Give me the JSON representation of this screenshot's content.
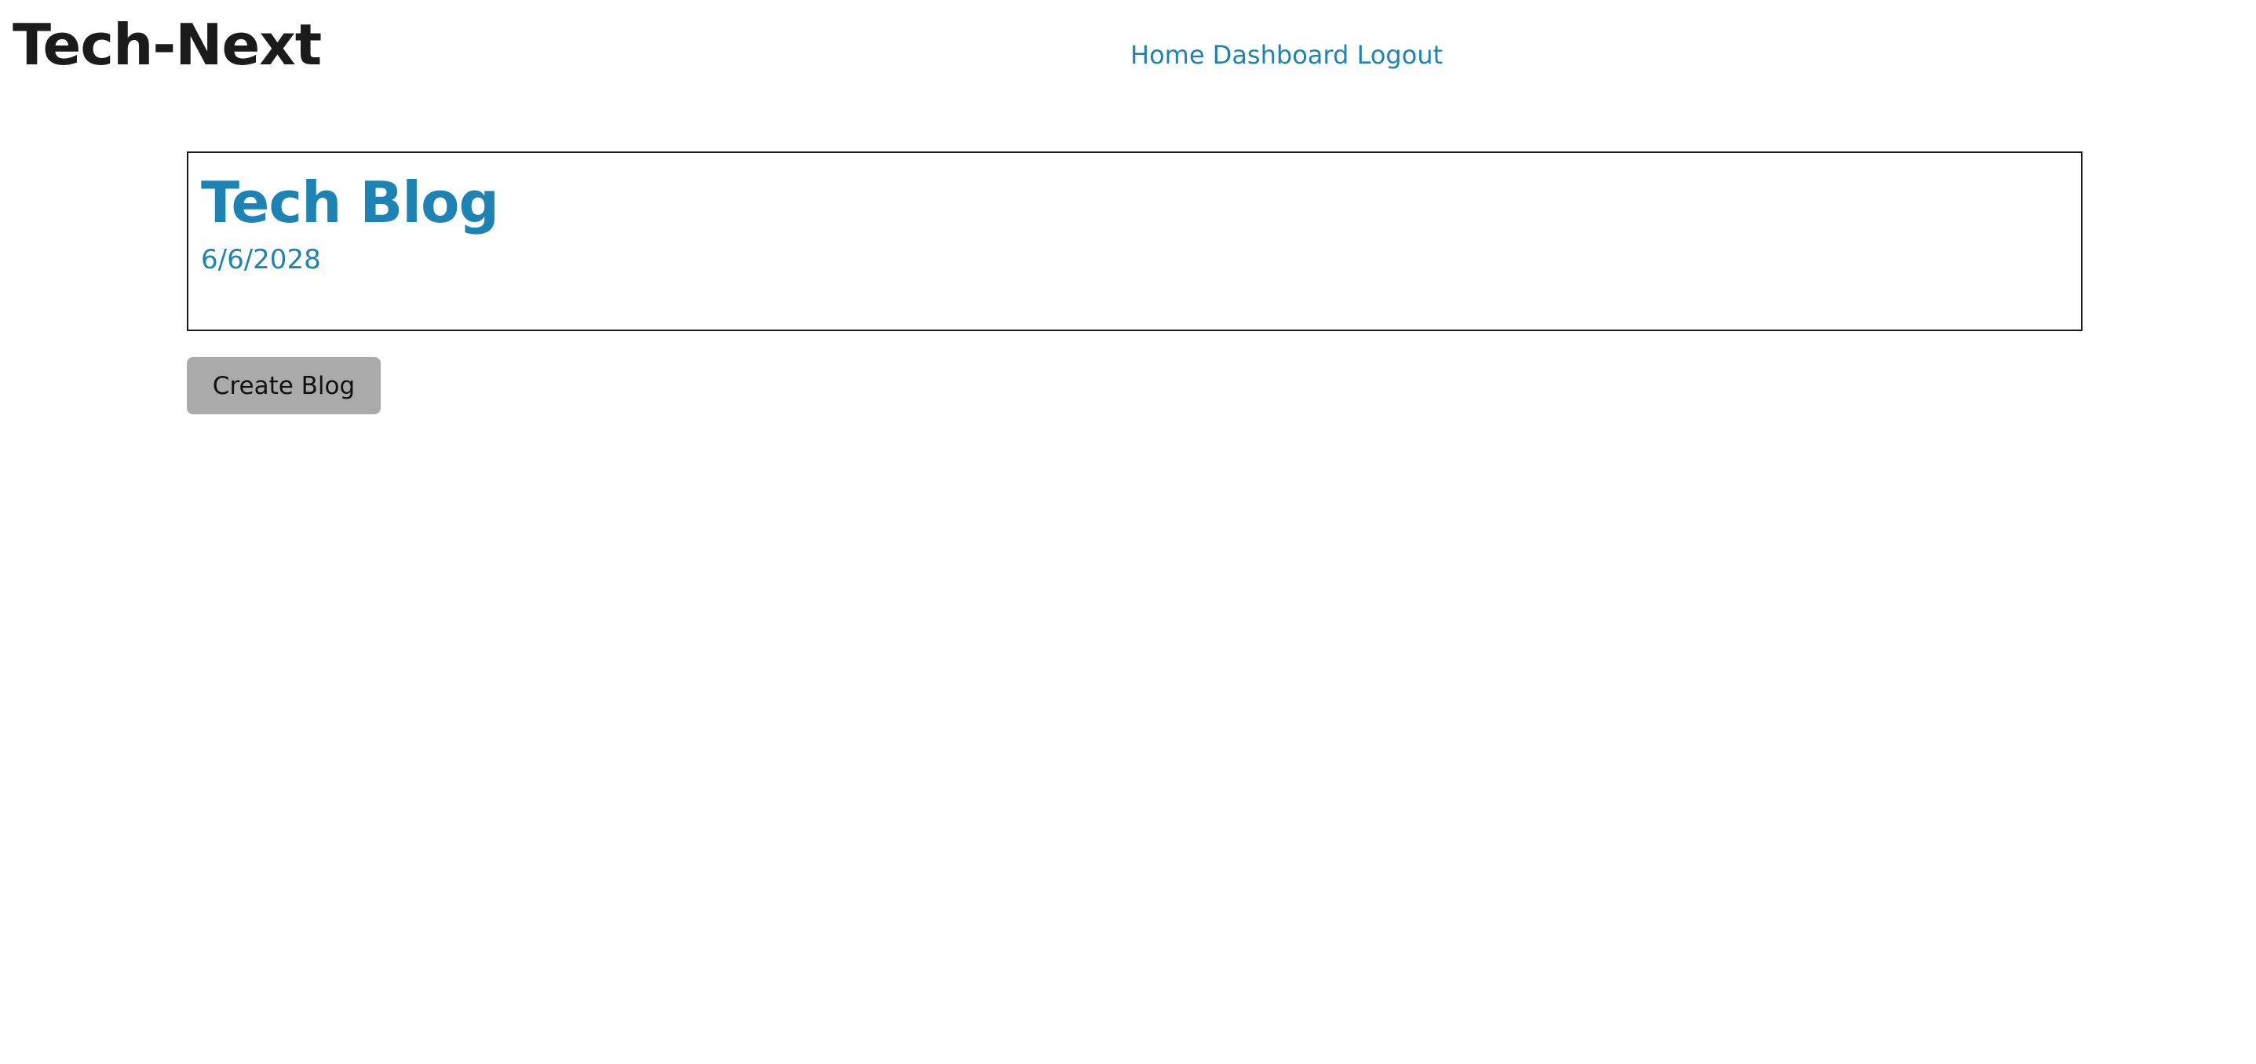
{
  "header": {
    "site_title": "Tech-Next",
    "nav": [
      {
        "label": "Home"
      },
      {
        "label": "Dashboard"
      },
      {
        "label": "Logout"
      }
    ]
  },
  "main": {
    "posts": [
      {
        "title": "Tech Blog",
        "date": "6/6/2028"
      }
    ],
    "create_button_label": "Create Blog"
  },
  "colors": {
    "link": "#1d83b5",
    "title_text": "#1b1b1b",
    "button_bg": "#aaaaaa",
    "card_border": "#1a1a1a"
  }
}
